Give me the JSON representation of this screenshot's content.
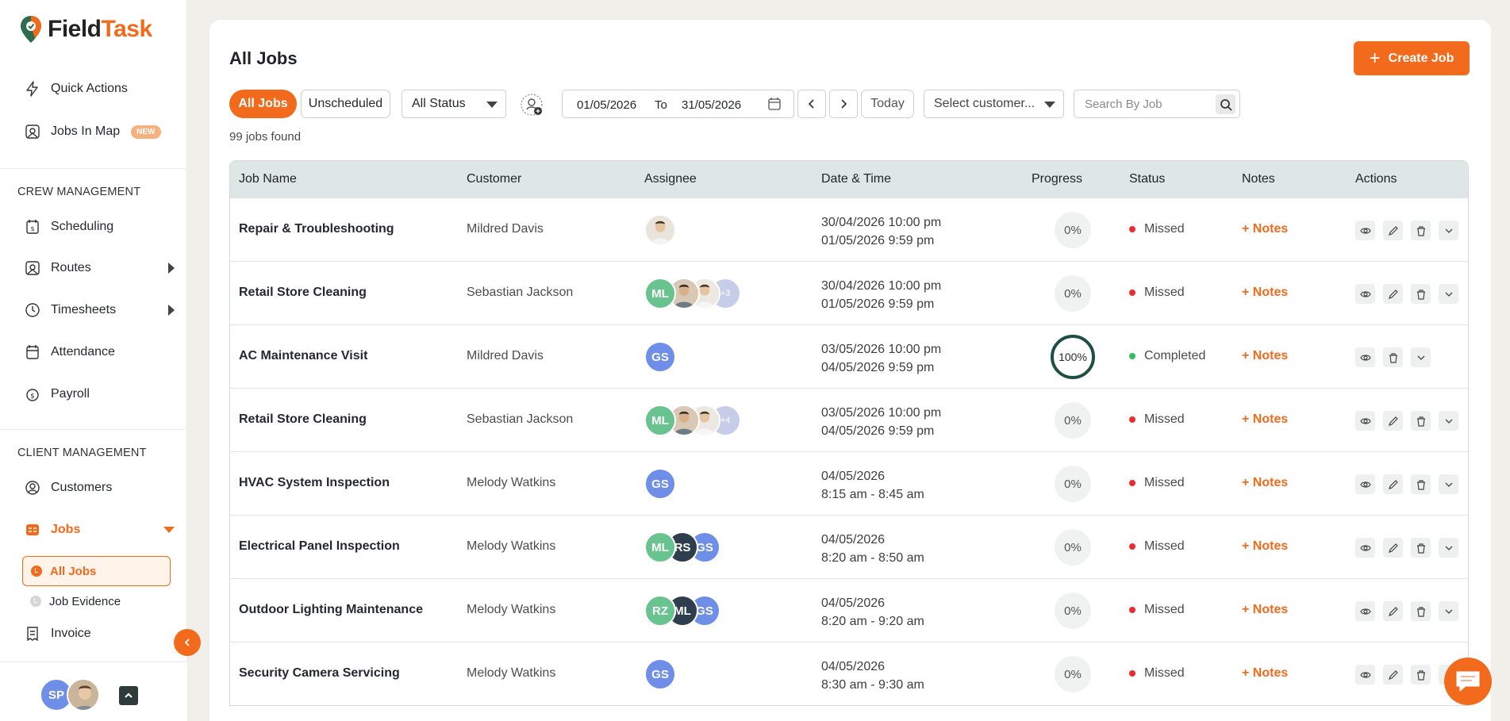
{
  "app": {
    "brand_first": "Field",
    "brand_second": "Task",
    "accent_color": "#f26a1b"
  },
  "sidebar": {
    "top_items": [
      {
        "label": "Quick Actions",
        "icon": "lightning-icon"
      },
      {
        "label": "Jobs In Map",
        "icon": "map-icon",
        "badge": "NEW"
      }
    ],
    "crew_title": "CREW MANAGEMENT",
    "crew_items": [
      {
        "label": "Scheduling",
        "icon": "calendar-dollar-icon"
      },
      {
        "label": "Routes",
        "icon": "map-icon"
      },
      {
        "label": "Timesheets",
        "icon": "clock-icon"
      },
      {
        "label": "Attendance",
        "icon": "calendar-icon"
      },
      {
        "label": "Payroll",
        "icon": "dollar-circle-icon"
      }
    ],
    "client_title": "CLIENT MANAGEMENT",
    "client_items": [
      {
        "label": "Customers",
        "icon": "user-circle-icon"
      },
      {
        "label": "Jobs",
        "icon": "jobs-icon"
      }
    ],
    "jobs_sub": [
      {
        "label": "All Jobs"
      },
      {
        "label": "Job Evidence"
      }
    ],
    "invoice_label": "Invoice",
    "user_initials": "SP"
  },
  "main": {
    "title": "All Jobs",
    "create_label": "Create Job",
    "filters": {
      "all_jobs": "All Jobs",
      "unscheduled": "Unscheduled",
      "status": "All Status",
      "date_from": "01/05/2026",
      "date_to_label": "To",
      "date_to": "31/05/2026",
      "today": "Today",
      "customer": "Select customer...",
      "search_placeholder": "Search By Job"
    },
    "found_text": "99 jobs found",
    "columns": [
      "Job Name",
      "Customer",
      "Assignee",
      "Date & Time",
      "Progress",
      "Status",
      "Notes",
      "Actions"
    ],
    "rows": [
      {
        "job": "Repair & Troubleshooting",
        "customer": "Mildred Davis",
        "date1": "30/04/2026 10:00 pm",
        "date2": "01/05/2026 9:59 pm",
        "progress": "0%",
        "status": "Missed",
        "notes": "+ Notes"
      },
      {
        "job": "Retail Store Cleaning",
        "customer": "Sebastian Jackson",
        "date1": "30/04/2026 10:00 pm",
        "date2": "01/05/2026 9:59 pm",
        "progress": "0%",
        "status": "Missed",
        "notes": "+ Notes",
        "more": "+3"
      },
      {
        "job": "AC Maintenance Visit",
        "customer": "Mildred Davis",
        "date1": "03/05/2026 10:00 pm",
        "date2": "04/05/2026 9:59 pm",
        "progress": "100%",
        "status": "Completed",
        "notes": "+ Notes"
      },
      {
        "job": "Retail Store Cleaning",
        "customer": "Sebastian Jackson",
        "date1": "03/05/2026 10:00 pm",
        "date2": "04/05/2026 9:59 pm",
        "progress": "0%",
        "status": "Missed",
        "notes": "+ Notes",
        "more": "+4"
      },
      {
        "job": "HVAC System Inspection",
        "customer": "Melody Watkins",
        "date1": "04/05/2026",
        "date2": "8:15 am - 8:45 am",
        "progress": "0%",
        "status": "Missed",
        "notes": "+ Notes"
      },
      {
        "job": "Electrical Panel Inspection",
        "customer": "Melody Watkins",
        "date1": "04/05/2026",
        "date2": "8:20 am - 8:50 am",
        "progress": "0%",
        "status": "Missed",
        "notes": "+ Notes"
      },
      {
        "job": "Outdoor Lighting Maintenance",
        "customer": "Melody Watkins",
        "date1": "04/05/2026",
        "date2": "8:20 am - 9:20 am",
        "progress": "0%",
        "status": "Missed",
        "notes": "+ Notes"
      },
      {
        "job": "Security Camera Servicing",
        "customer": "Melody Watkins",
        "date1": "04/05/2026",
        "date2": "8:30 am - 9:30 am",
        "progress": "0%",
        "status": "Missed",
        "notes": "+ Notes"
      }
    ],
    "avatars": {
      "ml": "ML",
      "gs": "GS",
      "rs": "RS",
      "rz": "RZ"
    },
    "status_colors": {
      "missed": "#ee2b2b",
      "completed": "#2fbf5b"
    }
  }
}
